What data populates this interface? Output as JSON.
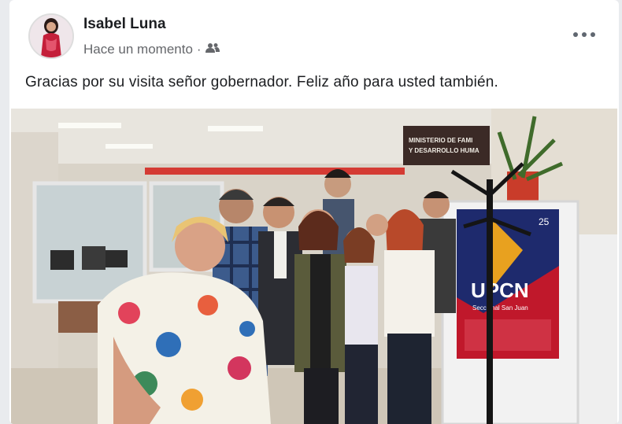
{
  "post": {
    "author": "Isabel Luna",
    "timestamp": "Hace un momento",
    "separator": "·",
    "audience_icon": "friends-icon",
    "more_icon": "more-options-icon",
    "text": "Gracias por su visita señor gobernador. Feliz año para usted también."
  },
  "photo": {
    "sign_line1": "MINISTERIO DE FAMI",
    "sign_line2": "Y DESARROLLO HUMA",
    "banner_logo": "UPCN",
    "banner_sub": "Seccional San Juan",
    "banner_year": "25",
    "colors": {
      "banner_red": "#c0182b",
      "banner_blue": "#1e2a6d",
      "sign_bg": "#3b2a26"
    }
  }
}
